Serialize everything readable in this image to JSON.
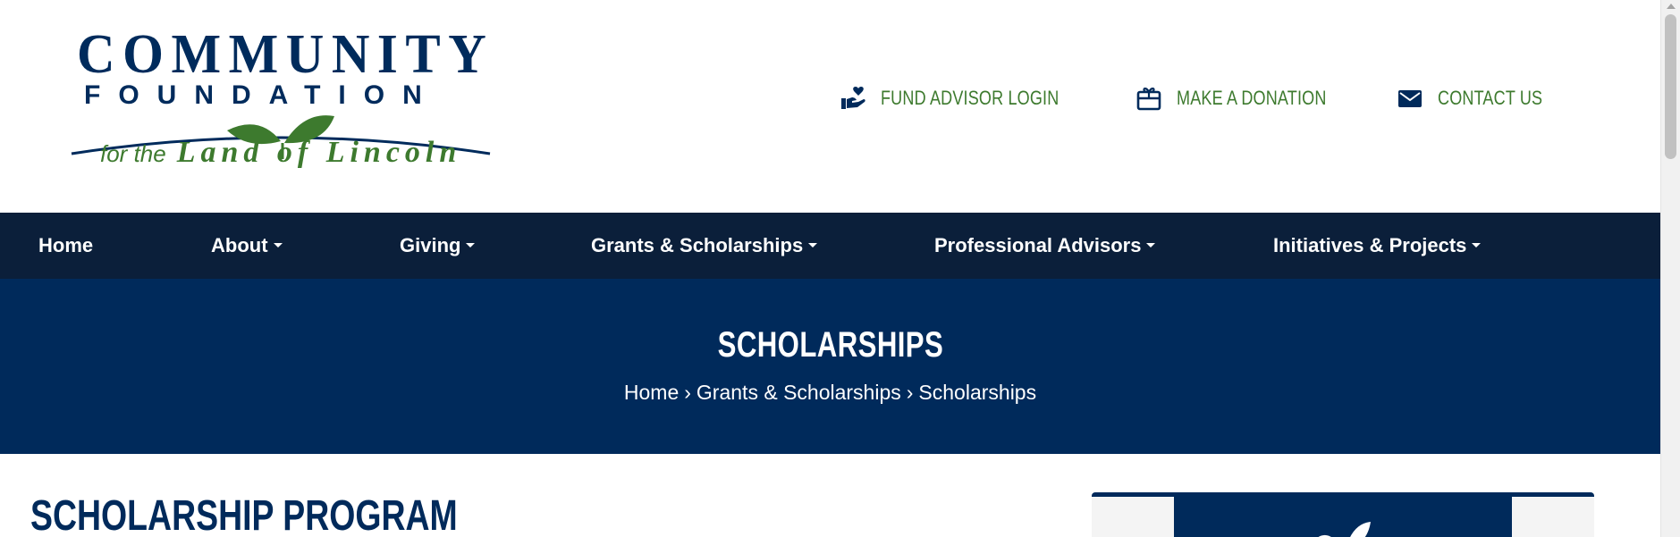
{
  "logo": {
    "line1": "COMMUNITY",
    "line2": "FOUNDATION",
    "tagline_small": "for the",
    "tagline_big": "Land of Lincoln",
    "colors": {
      "navy": "#002b5c",
      "green": "#3d7a2e"
    }
  },
  "utility_nav": {
    "items": [
      {
        "label": "FUND ADVISOR LOGIN",
        "icon": "hand-heart-icon"
      },
      {
        "label": "MAKE A DONATION",
        "icon": "gift-card-icon"
      },
      {
        "label": "CONTACT US",
        "icon": "envelope-icon"
      }
    ]
  },
  "main_nav": {
    "items": [
      {
        "label": "Home",
        "has_dropdown": false
      },
      {
        "label": "About",
        "has_dropdown": true
      },
      {
        "label": "Giving",
        "has_dropdown": true
      },
      {
        "label": "Grants & Scholarships",
        "has_dropdown": true
      },
      {
        "label": "Professional Advisors",
        "has_dropdown": true
      },
      {
        "label": "Initiatives & Projects",
        "has_dropdown": true
      }
    ]
  },
  "hero": {
    "title": "SCHOLARSHIPS",
    "breadcrumb": [
      "Home",
      "Grants & Scholarships",
      "Scholarships"
    ],
    "separator": "›"
  },
  "content": {
    "heading": "SCHOLARSHIP PROGRAM"
  },
  "theme": {
    "nav_bg": "#0b1f3a",
    "hero_bg": "#002a5b",
    "accent_green": "#3d7a2e"
  }
}
